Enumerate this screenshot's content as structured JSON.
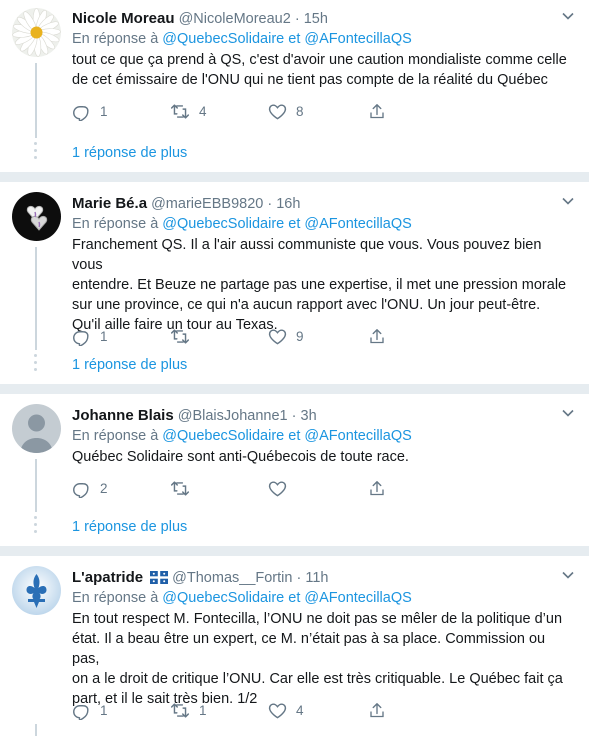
{
  "reply_prefix": "En réponse à",
  "reply_joiner": "et",
  "tweets": [
    {
      "name": "Nicole Moreau",
      "handle": "@NicoleMoreau2",
      "dot": "·",
      "time": "15h",
      "reply_to": [
        "@QuebecSolidaire",
        "@AFontecillaQS"
      ],
      "lines": [
        "tout ce que ça prend à QS, c'est d'avoir une caution mondialiste comme celle",
        "de cet émissaire de l'ONU qui ne tient pas compte de la réalité du Québec"
      ],
      "replies": "1",
      "retweets": "4",
      "likes": "8"
    },
    {
      "name": "Marie Bé.a",
      "handle": "@marieEBB9820",
      "dot": "·",
      "time": "16h",
      "reply_to": [
        "@QuebecSolidaire",
        "@AFontecillaQS"
      ],
      "lines": [
        "Franchement QS. Il a l'air aussi communiste que vous. Vous pouvez bien vous",
        "entendre. Et Beuze ne partage pas une expertise, il met une pression morale",
        "sur une province, ce qui n'a aucun rapport avec l'ONU. Un jour peut-être.",
        "Qu'il aille faire un tour au Texas."
      ],
      "replies": "1",
      "retweets": "",
      "likes": "9"
    },
    {
      "name": "Johanne Blais",
      "handle": "@BlaisJohanne1",
      "dot": "·",
      "time": "3h",
      "reply_to": [
        "@QuebecSolidaire",
        "@AFontecillaQS"
      ],
      "lines": [
        "Québec Solidaire sont anti-Québecois de toute race."
      ],
      "replies": "2",
      "retweets": "",
      "likes": ""
    },
    {
      "name": "L'apatride",
      "handle": "@Thomas__Fortin",
      "dot": "·",
      "time": "11h",
      "reply_to": [
        "@QuebecSolidaire",
        "@AFontecillaQS"
      ],
      "lines": [
        "En tout respect M. Fontecilla, l’ONU ne doit pas se mêler de la politique d’un",
        "état. Il a beau être un expert, ce M. n’était pas à sa place. Commission ou pas,",
        "on a le droit de critique l’ONU. Car elle est très critiquable. Le Québec fait ça",
        "part, et il le sait très bien. 1/2"
      ],
      "replies": "1",
      "retweets": "1",
      "likes": "4"
    }
  ],
  "more_replies": "1 réponse de plus",
  "colors": {
    "link": "#1b95e0",
    "muted": "#657786",
    "separator": "#e6ecf0",
    "thread": "#ccd6dd"
  }
}
